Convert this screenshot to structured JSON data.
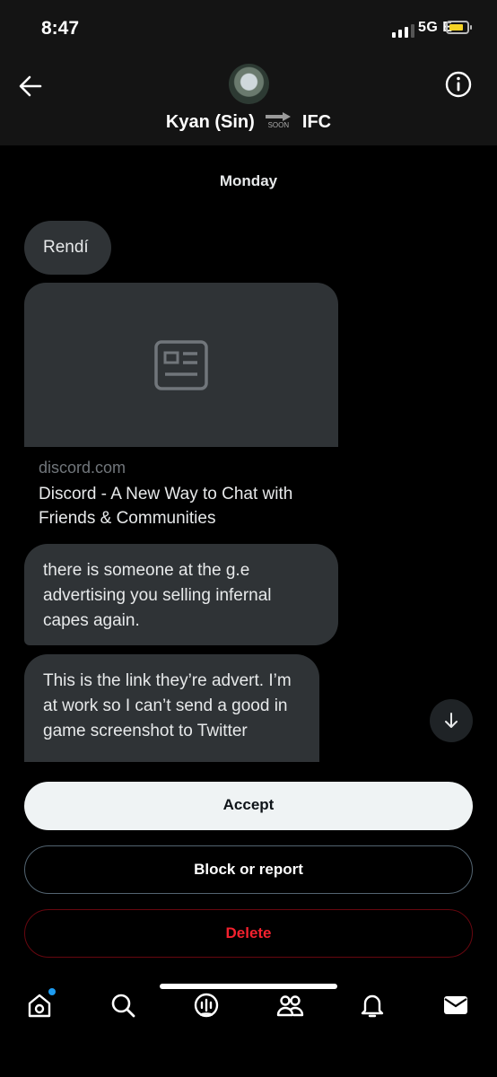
{
  "status_bar": {
    "time": "8:47",
    "network": "5G E"
  },
  "header": {
    "name_left": "Kyan (Sin)",
    "soon_label": "SOON",
    "name_right": "IFC"
  },
  "conversation": {
    "day_label": "Monday",
    "messages": [
      {
        "text": "Rendí"
      },
      {
        "link_domain": "discord.com",
        "link_title": "Discord - A New Way to Chat with Friends & Communities"
      },
      {
        "text": "there is someone at the g.e advertising you selling infernal capes again."
      },
      {
        "text": "This is the link they’re advert. I’m at work so I can’t send a good in game screenshot to Twitter"
      }
    ]
  },
  "actions": {
    "accept": "Accept",
    "block_report": "Block or report",
    "delete": "Delete"
  },
  "tabbar": {
    "items": [
      "home-icon",
      "search-icon",
      "spaces-icon",
      "communities-icon",
      "notifications-icon",
      "messages-icon"
    ]
  },
  "colors": {
    "accept_bg": "#eff3f4",
    "delete_text": "#f4212e",
    "bubble_bg": "#2f3336",
    "unread_dot": "#1d9bf0"
  }
}
